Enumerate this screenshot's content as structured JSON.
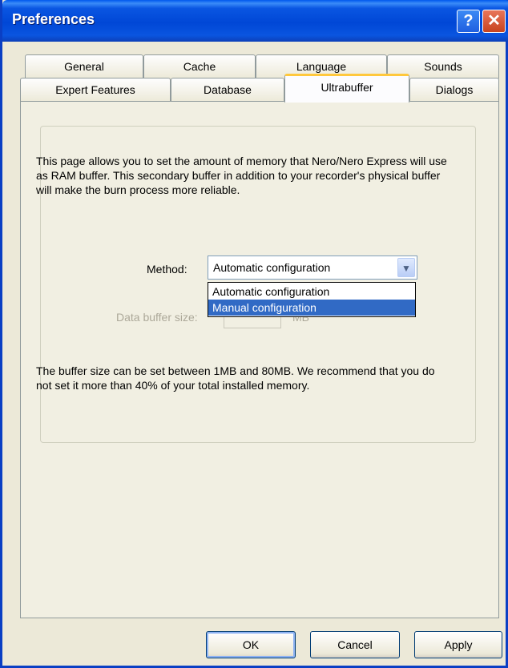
{
  "window": {
    "title": "Preferences"
  },
  "titlebar": {
    "help_glyph": "?",
    "close_glyph": "✕"
  },
  "tabs": {
    "row1": [
      "General",
      "Cache",
      "Language",
      "Sounds"
    ],
    "row2": [
      "Expert Features",
      "Database",
      "Ultrabuffer",
      "Dialogs"
    ],
    "active": "Ultrabuffer"
  },
  "panel": {
    "description": "This page allows you to set the amount of memory that Nero/Nero Express will use as RAM buffer. This secondary buffer in addition to your recorder's physical buffer will make the burn process more reliable.",
    "method_label": "Method:",
    "method_value": "Automatic configuration",
    "method_options": [
      "Automatic configuration",
      "Manual configuration"
    ],
    "highlighted_option": "Manual configuration",
    "buffer_label": "Data buffer size:",
    "buffer_unit": "MB",
    "note": "The buffer size can be set between 1MB and 80MB. We recommend that you do not set it more than 40% of your total installed memory."
  },
  "buttons": {
    "ok": "OK",
    "cancel": "Cancel",
    "apply": "Apply"
  },
  "colors": {
    "titlebar": "#0a56e2",
    "selection": "#316ac5",
    "active_tab_accent": "#ffc83c"
  }
}
